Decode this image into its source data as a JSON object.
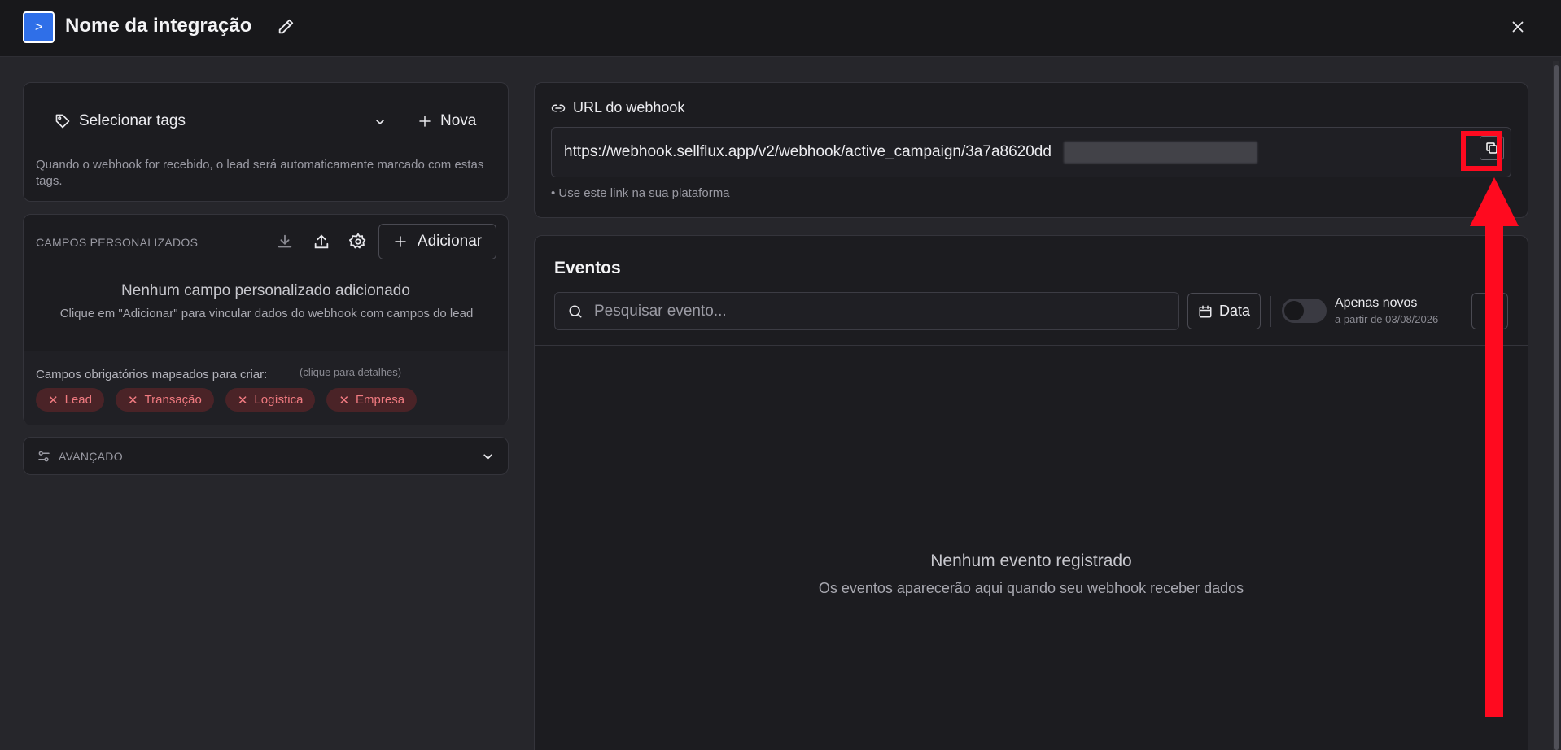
{
  "header": {
    "title": "Nome da integração"
  },
  "tags": {
    "select_label": "Selecionar tags",
    "new_label": "Nova",
    "help": "Quando o webhook for recebido, o lead será automaticamente marcado com estas tags."
  },
  "custom_fields": {
    "title": "CAMPOS PERSONALIZADOS",
    "add_label": "Adicionar",
    "empty_title": "Nenhum campo personalizado adicionado",
    "empty_sub": "Clique em \"Adicionar\" para vincular dados do webhook com campos do lead",
    "required_label": "Campos obrigatórios mapeados para criar:",
    "required_hint": "(clique para detalhes)",
    "chips": [
      "Lead",
      "Transação",
      "Logística",
      "Empresa"
    ]
  },
  "advanced": {
    "label": "AVANÇADO"
  },
  "webhook": {
    "title": "URL do webhook",
    "url": "https://webhook.sellflux.app/v2/webhook/active_campaign/3a7a8620dd",
    "hint": "• Use este link na sua plataforma"
  },
  "events": {
    "title": "Eventos",
    "search_placeholder": "Pesquisar evento...",
    "date_label": "Data",
    "toggle_label": "Apenas novos",
    "toggle_sub": "a partir de 03/08/2026",
    "empty_title": "Nenhum evento registrado",
    "empty_sub": "Os eventos aparecerão aqui quando seu webhook receber dados"
  },
  "colors": {
    "accent": "#2f6fe8",
    "highlight": "#ff0a1f",
    "chip_bg": "#4a2327",
    "chip_text": "#f07a80"
  },
  "icons": [
    "integration-logo-icon",
    "pencil-icon",
    "close-icon",
    "tag-icon",
    "chevron-down-icon",
    "plus-icon",
    "download-icon",
    "upload-icon",
    "gear-icon",
    "sliders-icon",
    "link-icon",
    "copy-icon",
    "search-icon",
    "calendar-icon"
  ]
}
